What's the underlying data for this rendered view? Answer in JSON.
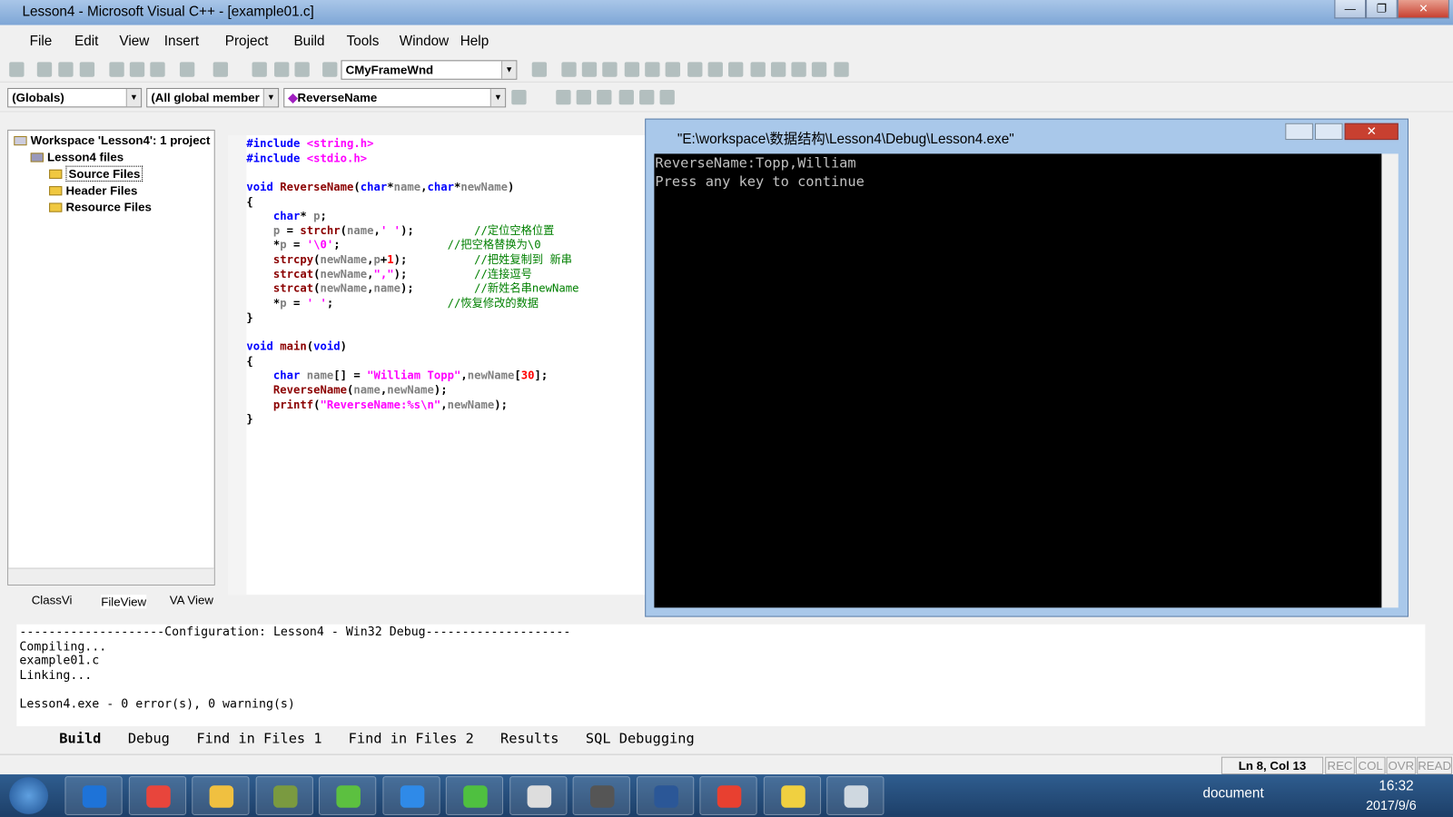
{
  "window": {
    "title": "Lesson4 - Microsoft Visual C++ - [example01.c]"
  },
  "menu": [
    "File",
    "Edit",
    "View",
    "Insert",
    "Project",
    "Build",
    "Tools",
    "Window",
    "Help"
  ],
  "toolbar": {
    "class_combo": "CMyFrameWnd",
    "scope_combo": "(Globals)",
    "members_combo": "(All global member",
    "function_combo": "ReverseName"
  },
  "workspace": {
    "root": "Workspace 'Lesson4': 1 project",
    "project": "Lesson4 files",
    "folders": [
      "Source Files",
      "Header Files",
      "Resource Files"
    ],
    "tabs": [
      "ClassVi",
      "FileView",
      "VA View"
    ]
  },
  "code": [
    [
      [
        "kw",
        "#include "
      ],
      [
        "str",
        "<string.h>"
      ]
    ],
    [
      [
        "kw",
        "#include "
      ],
      [
        "str",
        "<stdio.h>"
      ]
    ],
    [],
    [
      [
        "kw",
        "void "
      ],
      [
        "fn",
        "ReverseName"
      ],
      [
        "pl",
        "("
      ],
      [
        "kw",
        "char"
      ],
      [
        "pl",
        "*"
      ],
      [
        "id",
        "name"
      ],
      [
        "pl",
        ","
      ],
      [
        "kw",
        "char"
      ],
      [
        "pl",
        "*"
      ],
      [
        "id",
        "newName"
      ],
      [
        "pl",
        ")"
      ]
    ],
    [
      [
        "pl",
        "{"
      ]
    ],
    [
      [
        "pl",
        "    "
      ],
      [
        "kw",
        "char"
      ],
      [
        "pl",
        "* "
      ],
      [
        "id",
        "p"
      ],
      [
        "pl",
        ";"
      ]
    ],
    [
      [
        "pl",
        "    "
      ],
      [
        "id",
        "p"
      ],
      [
        "pl",
        " = "
      ],
      [
        "fn",
        "strchr"
      ],
      [
        "pl",
        "("
      ],
      [
        "id",
        "name"
      ],
      [
        "pl",
        ","
      ],
      [
        "str",
        "' '"
      ],
      [
        "pl",
        ");         "
      ],
      [
        "cm",
        "//定位空格位置"
      ]
    ],
    [
      [
        "pl",
        "    *"
      ],
      [
        "id",
        "p"
      ],
      [
        "pl",
        " = "
      ],
      [
        "str",
        "'\\0'"
      ],
      [
        "pl",
        ";                "
      ],
      [
        "cm",
        "//把空格替换为\\0"
      ]
    ],
    [
      [
        "pl",
        "    "
      ],
      [
        "fn",
        "strcpy"
      ],
      [
        "pl",
        "("
      ],
      [
        "id",
        "newName"
      ],
      [
        "pl",
        ","
      ],
      [
        "id",
        "p"
      ],
      [
        "pl",
        "+"
      ],
      [
        "num",
        "1"
      ],
      [
        "pl",
        ");          "
      ],
      [
        "cm",
        "//把姓复制到 新串"
      ]
    ],
    [
      [
        "pl",
        "    "
      ],
      [
        "fn",
        "strcat"
      ],
      [
        "pl",
        "("
      ],
      [
        "id",
        "newName"
      ],
      [
        "pl",
        ","
      ],
      [
        "str",
        "\",\""
      ],
      [
        "pl",
        ");          "
      ],
      [
        "cm",
        "//连接逗号"
      ]
    ],
    [
      [
        "pl",
        "    "
      ],
      [
        "fn",
        "strcat"
      ],
      [
        "pl",
        "("
      ],
      [
        "id",
        "newName"
      ],
      [
        "pl",
        ","
      ],
      [
        "id",
        "name"
      ],
      [
        "pl",
        ");         "
      ],
      [
        "cm",
        "//新姓名串newName"
      ]
    ],
    [
      [
        "pl",
        "    *"
      ],
      [
        "id",
        "p"
      ],
      [
        "pl",
        " = "
      ],
      [
        "str",
        "' '"
      ],
      [
        "pl",
        ";                 "
      ],
      [
        "cm",
        "//恢复修改的数据"
      ]
    ],
    [
      [
        "pl",
        "}"
      ]
    ],
    [],
    [
      [
        "kw",
        "void "
      ],
      [
        "fn",
        "main"
      ],
      [
        "pl",
        "("
      ],
      [
        "kw",
        "void"
      ],
      [
        "pl",
        ")"
      ]
    ],
    [
      [
        "pl",
        "{"
      ]
    ],
    [
      [
        "pl",
        "    "
      ],
      [
        "kw",
        "char "
      ],
      [
        "id",
        "name"
      ],
      [
        "pl",
        "[] = "
      ],
      [
        "str",
        "\"William Topp\""
      ],
      [
        "pl",
        ","
      ],
      [
        "id",
        "newName"
      ],
      [
        "pl",
        "["
      ],
      [
        "num",
        "30"
      ],
      [
        "pl",
        "];"
      ]
    ],
    [
      [
        "pl",
        "    "
      ],
      [
        "fn",
        "ReverseName"
      ],
      [
        "pl",
        "("
      ],
      [
        "id",
        "name"
      ],
      [
        "pl",
        ","
      ],
      [
        "id",
        "newName"
      ],
      [
        "pl",
        ");"
      ]
    ],
    [
      [
        "pl",
        "    "
      ],
      [
        "fn",
        "printf"
      ],
      [
        "pl",
        "("
      ],
      [
        "str",
        "\"ReverseName:%s\\n\""
      ],
      [
        "pl",
        ","
      ],
      [
        "id",
        "newName"
      ],
      [
        "pl",
        ");"
      ]
    ],
    [
      [
        "pl",
        "}"
      ]
    ]
  ],
  "console": {
    "title": "\"E:\\workspace\\数据结构\\Lesson4\\Debug\\Lesson4.exe\"",
    "output": "ReverseName:Topp,William\nPress any key to continue"
  },
  "build_output": "--------------------Configuration: Lesson4 - Win32 Debug--------------------\nCompiling...\nexample01.c\nLinking...\n\nLesson4.exe - 0 error(s), 0 warning(s)",
  "output_tabs": [
    "Build",
    "Debug",
    "Find in Files 1",
    "Find in Files 2",
    "Results",
    "SQL Debugging"
  ],
  "status": {
    "position": "Ln 8, Col 13",
    "rec": "REC",
    "col": "COL",
    "ovr": "OVR",
    "read": "READ"
  },
  "taskbar": {
    "document": "document",
    "time": "16:32",
    "date": "2017/9/6",
    "apps": [
      "ie",
      "chrome",
      "explorer",
      "notepad",
      "app-green",
      "app-blue",
      "wechat",
      "app-people",
      "app-ide",
      "word",
      "app-colorful",
      "help",
      "app-window"
    ],
    "app_colors": [
      "#1e73d8",
      "#e8453c",
      "#f0c040",
      "#7a9a40",
      "#5cc040",
      "#2f8ae8",
      "#4fc040",
      "#ddd",
      "#555",
      "#2b5797",
      "#e84030",
      "#f0d040",
      "#cfd8e0"
    ]
  }
}
